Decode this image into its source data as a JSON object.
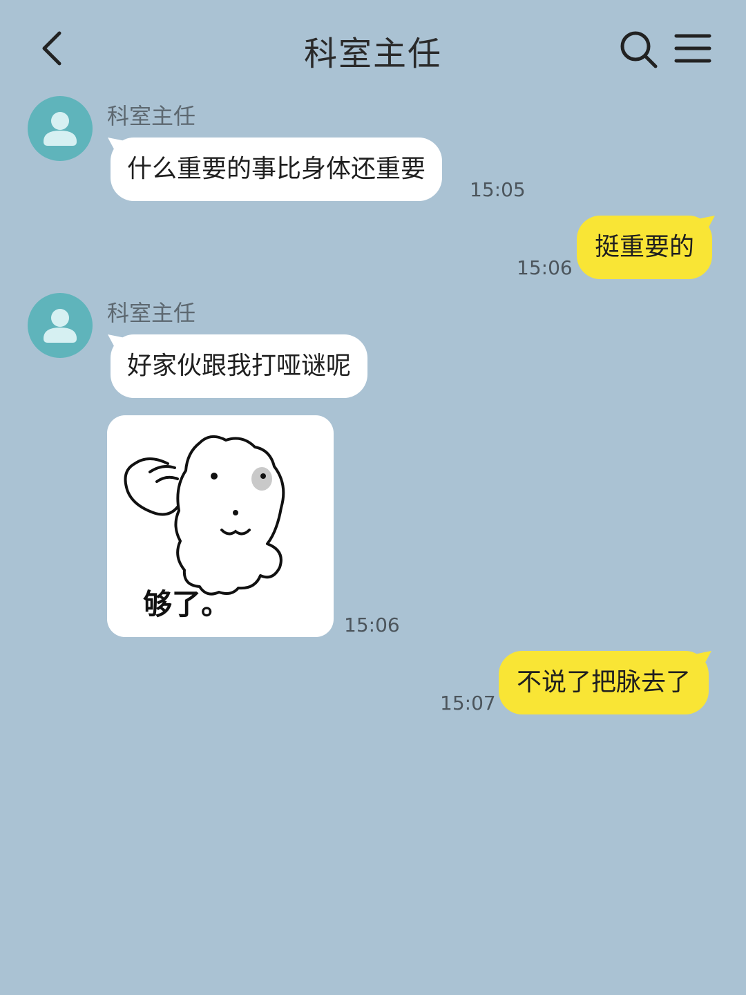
{
  "header": {
    "title": "科室主任"
  },
  "messages": [
    {
      "sender": "科室主任",
      "text": "什么重要的事比身体还重要",
      "time": "15:05"
    },
    {
      "text": "挺重要的",
      "time": "15:06"
    },
    {
      "sender": "科室主任",
      "text": "好家伙跟我打哑谜呢"
    },
    {
      "sticker_caption": "够了。",
      "time": "15:06"
    },
    {
      "text": "不说了把脉去了",
      "time": "15:07"
    }
  ],
  "icons": {
    "back": "chevron-left-icon",
    "search": "search-icon",
    "menu": "hamburger-menu-icon",
    "avatar": "person-icon"
  },
  "colors": {
    "background": "#aac2d3",
    "incoming_bubble": "#ffffff",
    "outgoing_bubble": "#f9e535",
    "avatar": "#5fb4bb"
  }
}
